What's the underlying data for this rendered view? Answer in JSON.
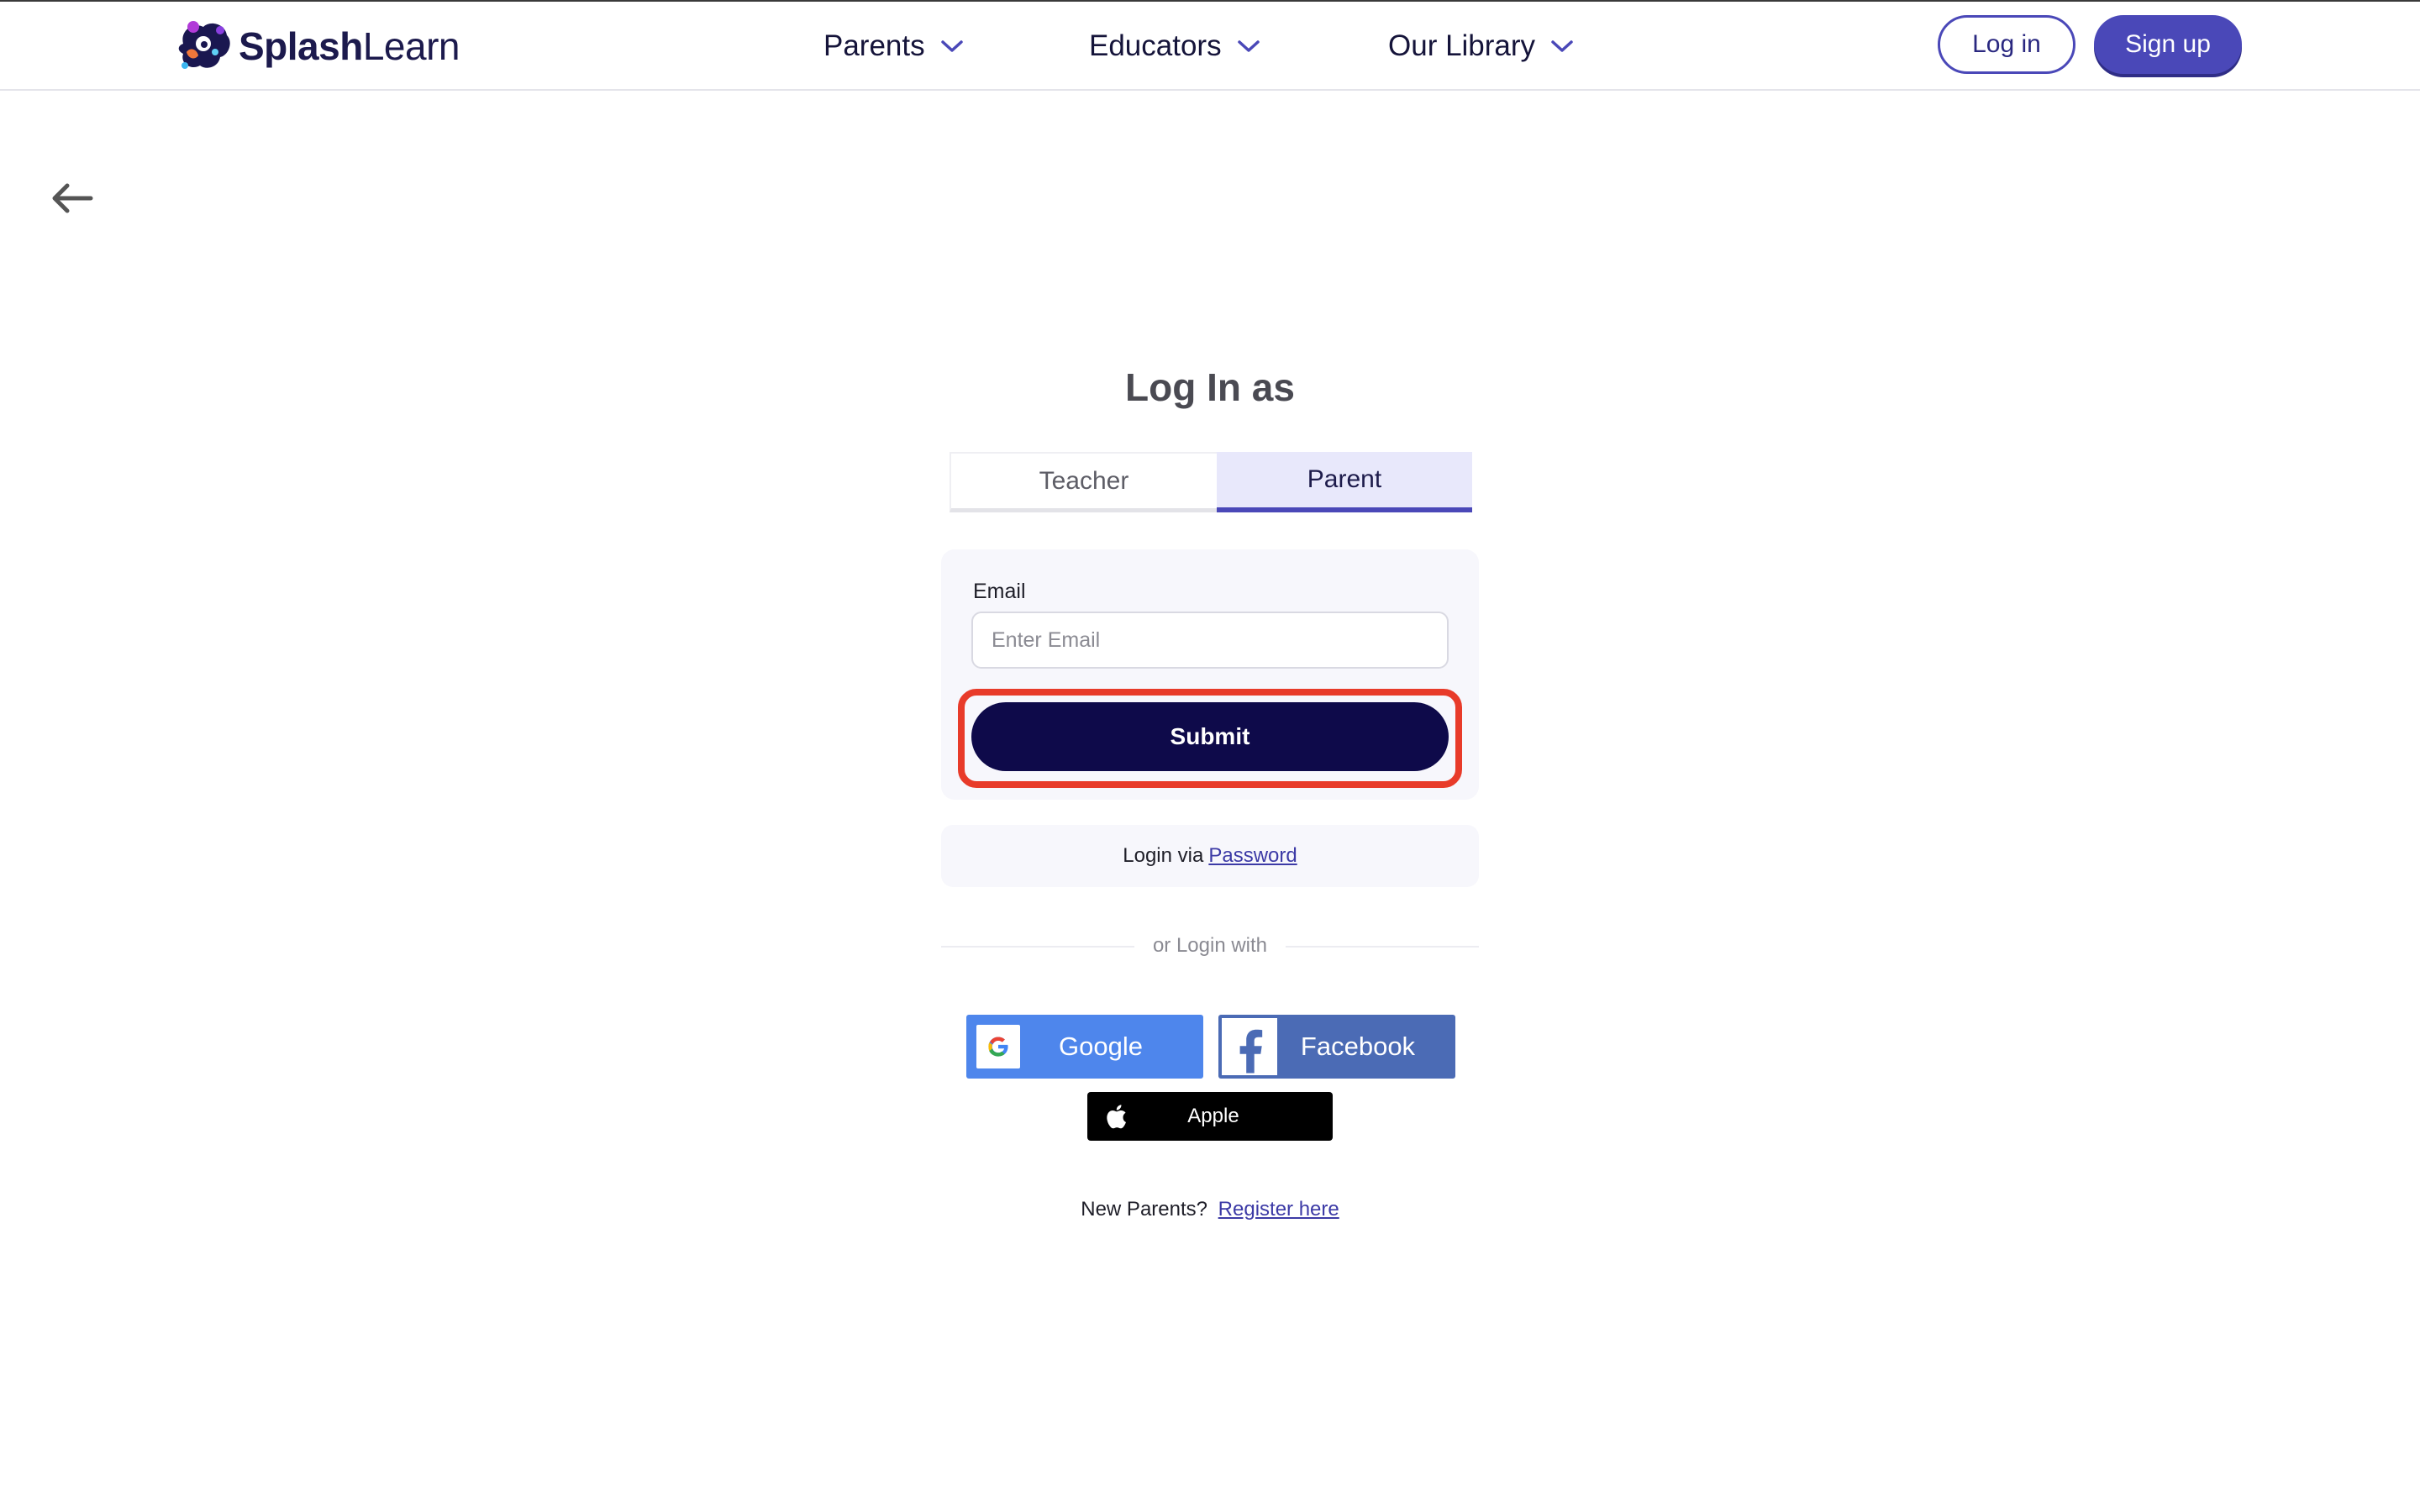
{
  "brand": {
    "name_bold": "Splash",
    "name_regular": "Learn",
    "primary_color": "#4a48b8",
    "dark_color": "#0e0a4a"
  },
  "nav": {
    "items": [
      {
        "label": "Parents",
        "icon": "chevron-down-icon"
      },
      {
        "label": "Educators",
        "icon": "chevron-down-icon"
      },
      {
        "label": "Our Library",
        "icon": "chevron-down-icon"
      }
    ],
    "login_label": "Log in",
    "signup_label": "Sign up"
  },
  "page": {
    "back_icon": "arrow-left-icon",
    "title": "Log In as",
    "tabs": [
      {
        "label": "Teacher",
        "active": false
      },
      {
        "label": "Parent",
        "active": true
      }
    ]
  },
  "form": {
    "email_label": "Email",
    "email_value": "",
    "email_placeholder": "Enter Email",
    "submit_label": "Submit",
    "highlight_color": "#e83b2a"
  },
  "password_login": {
    "prefix": "Login via",
    "link": "Password"
  },
  "divider_text": "or Login with",
  "social": {
    "google": {
      "label": "Google",
      "icon": "google-icon",
      "color": "#4e86ec"
    },
    "facebook": {
      "label": "Facebook",
      "icon": "facebook-icon",
      "color": "#4b6bb5"
    },
    "apple": {
      "label": "Apple",
      "icon": "apple-icon",
      "color": "#000000"
    }
  },
  "register": {
    "prefix": "New Parents?",
    "link": "Register here"
  }
}
